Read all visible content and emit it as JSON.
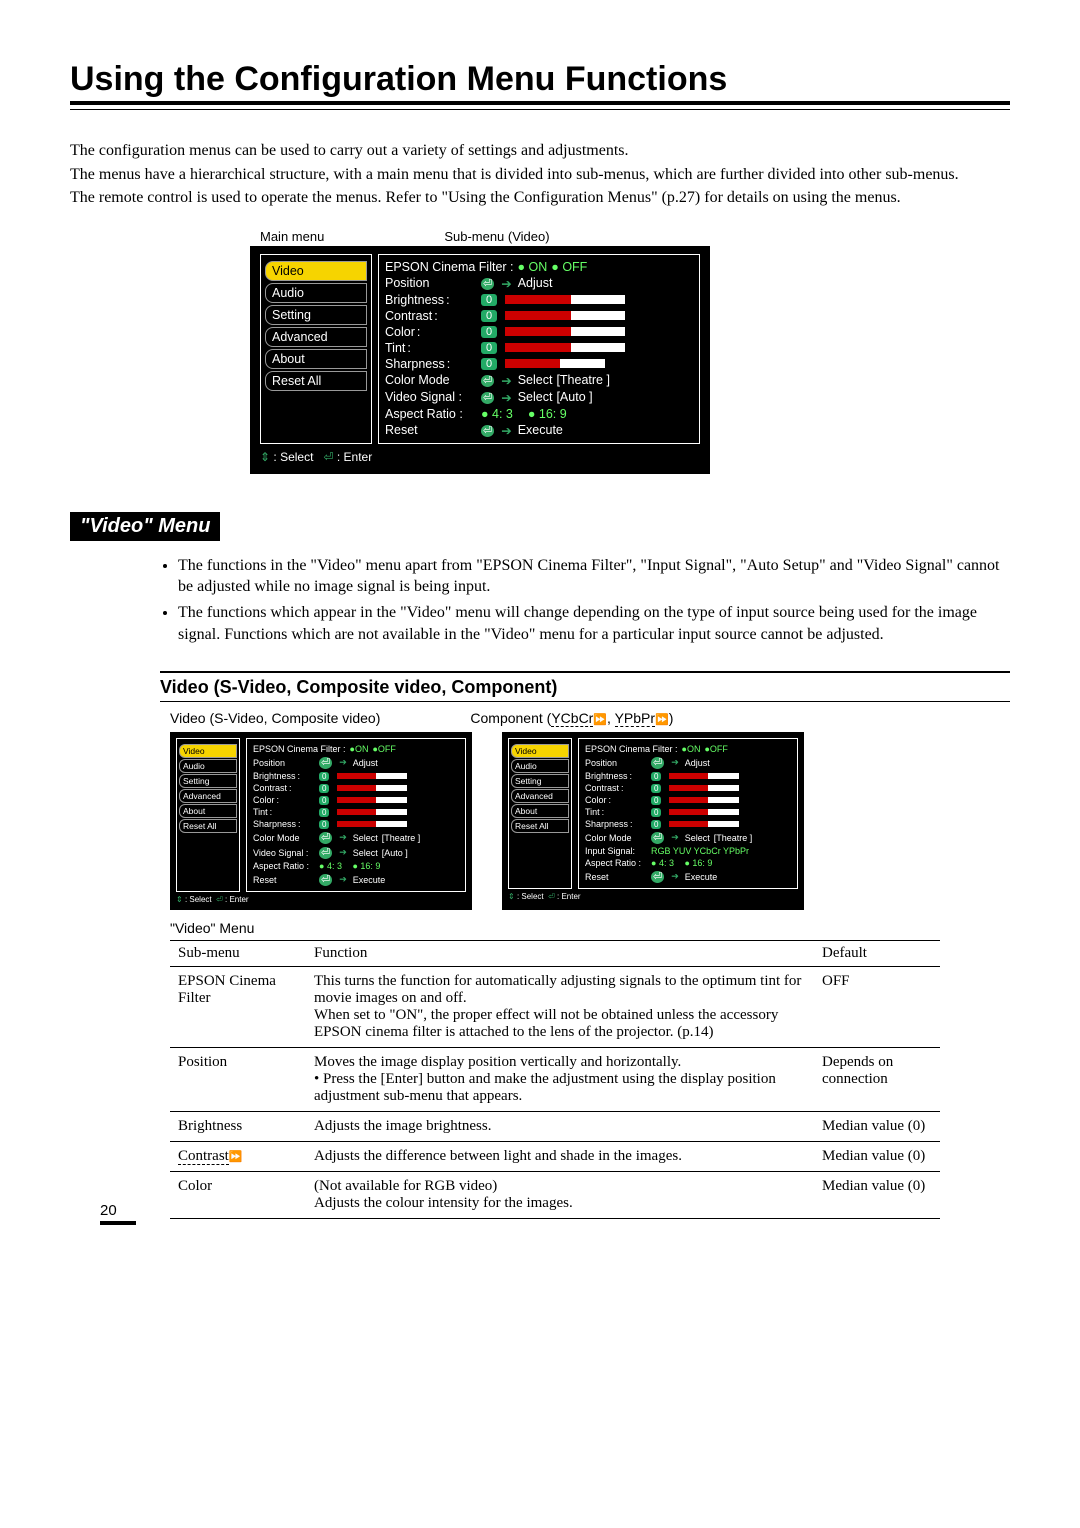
{
  "page_number": "20",
  "title": "Using the Configuration Menu Functions",
  "intro": [
    "The configuration menus can be used to carry out a variety of settings and adjustments.",
    "The menus have a hierarchical structure, with a main menu that is divided into sub-menus, which are further divided into other sub-menus.",
    "The remote control is used to operate the menus. Refer to \"Using the Configuration Menus\" (p.27) for details on using the menus."
  ],
  "labels": {
    "main": "Main menu",
    "sub": "Sub-menu (Video)"
  },
  "main_menu": [
    "Video",
    "Audio",
    "Setting",
    "Advanced",
    "About",
    "Reset All"
  ],
  "osd_big": {
    "cinema": "EPSON Cinema Filter :",
    "on": "ON",
    "off": "OFF",
    "position": "Position",
    "adjust": "Adjust",
    "brightness": "Brightness",
    "contrast": "Contrast",
    "color": "Color",
    "tint": "Tint",
    "sharpness": "Sharpness",
    "val": "0",
    "colormode": "Color Mode",
    "select": "Select",
    "theatre": "[Theatre        ]",
    "vsignal": "Video Signal :",
    "auto": "[Auto        ]",
    "aspect": "Aspect Ratio :",
    "a43": "4: 3",
    "a169": "16: 9",
    "reset": "Reset",
    "execute": "Execute",
    "footer_select": ": Select",
    "footer_enter": ": Enter"
  },
  "sec_video_heading": "\"Video\" Menu",
  "notes": [
    "The functions in the \"Video\" menu apart from \"EPSON Cinema Filter\", \"Input Signal\", \"Auto Setup\" and \"Video Signal\" cannot be adjusted while no image signal is being input.",
    "The functions which appear in the \"Video\" menu will change depending on the type of input source being used for the image signal. Functions which are not available in the \"Video\" menu for a particular input source cannot be adjusted."
  ],
  "sub_heading": "Video (S-Video, Composite video, Component)",
  "cap_left": "Video (S-Video, Composite video)",
  "cap_right_prefix": "Component (",
  "cap_right_a": "YCbCr",
  "cap_right_sep": ", ",
  "cap_right_b": "YPbPr",
  "cap_right_suffix": ")",
  "osd_small_right_extra": {
    "input": "Input Signal:",
    "opts": "RGB  YUV  YCbCr  YPbPr"
  },
  "table_caption": "\"Video\" Menu",
  "table_head": {
    "c1": "Sub-menu",
    "c2": "Function",
    "c3": "Default"
  },
  "rows": [
    {
      "name": "EPSON Cinema Filter",
      "func": "This turns the function for automatically adjusting signals to the optimum tint for movie images on and off.\nWhen set to \"ON\", the proper effect will not be obtained unless the accessory EPSON cinema filter is attached to the lens of the projector. (p.14)",
      "def": "OFF"
    },
    {
      "name": "Position",
      "func": "Moves the image display position vertically and horizontally.\n• Press the [Enter] button and make the adjustment using the display position adjustment sub-menu that appears.",
      "def": "Depends on connection"
    },
    {
      "name": "Brightness",
      "func": "Adjusts the image brightness.",
      "def": "Median value (0)"
    },
    {
      "name": "Contrast",
      "func": "Adjusts the difference between light and shade in the images.",
      "def": "Median value (0)",
      "gloss": true
    },
    {
      "name": "Color",
      "func": "(Not available for RGB video)\nAdjusts the colour intensity for the images.",
      "def": "Median value (0)"
    }
  ]
}
